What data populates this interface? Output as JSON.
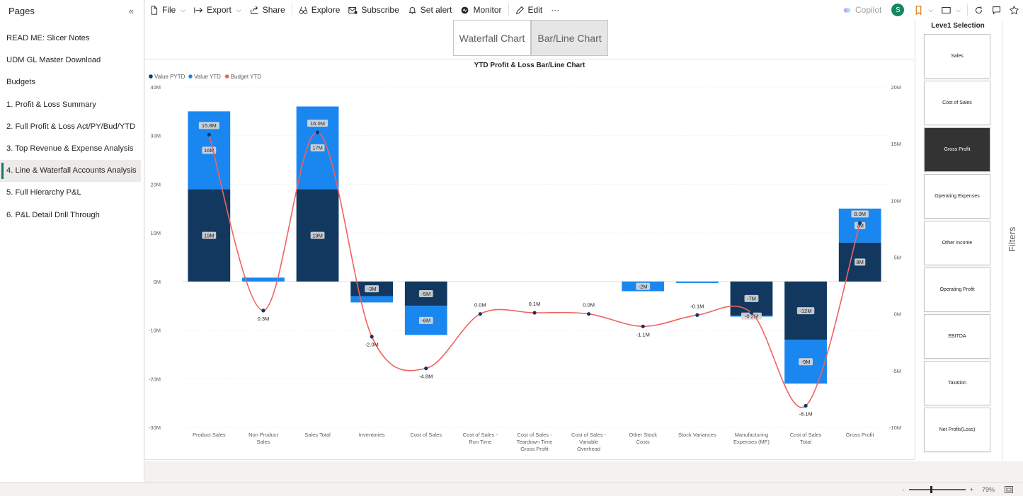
{
  "pages_pane": {
    "title": "Pages",
    "items": [
      {
        "label": "READ ME: Slicer Notes"
      },
      {
        "label": "UDM GL Master Download"
      },
      {
        "label": "Budgets"
      },
      {
        "label": "1. Profit & Loss Summary"
      },
      {
        "label": "2. Full Profit & Loss Act/PY/Bud/YTD"
      },
      {
        "label": "3. Top Revenue & Expense Analysis"
      },
      {
        "label": "4. Line & Waterfall Accounts Analysis"
      },
      {
        "label": "5. Full Hierarchy P&L"
      },
      {
        "label": "6. P&L Detail Drill Through"
      }
    ],
    "active_index": 6
  },
  "toolbar": {
    "file": "File",
    "export": "Export",
    "share": "Share",
    "explore": "Explore",
    "subscribe": "Subscribe",
    "set_alert": "Set alert",
    "monitor": "Monitor",
    "edit": "Edit",
    "more": "···",
    "copilot": "Copilot",
    "avatar_initial": "S"
  },
  "chart_tabs": {
    "waterfall": "Waterfall Chart",
    "barline": "Bar/Line Chart",
    "selected": "barline"
  },
  "slicer": {
    "title": "Leve1 Selection",
    "options": [
      "Sales",
      "Cost of Sales",
      "Gross Profit",
      "Operating Expenses",
      "Other Income",
      "Operating Profit",
      "EBITDA",
      "Taxation",
      "Net Profit/(Loss)"
    ],
    "selected": "Gross Profit"
  },
  "filters_label": "Filters",
  "status": {
    "minus": "-",
    "plus": "+",
    "zoom": "79%"
  },
  "colors": {
    "pytd": "#12385f",
    "ytd": "#1a87f0",
    "budget": "#f0625f",
    "accent": "#117865"
  },
  "chart_data": {
    "type": "bar",
    "title": "YTD Profit & Loss Bar/Line Chart",
    "legend_position": "top-left",
    "categories": [
      "Product Sales",
      "Non Product Sales",
      "Sales Total",
      "Inventories",
      "Cost of Sales",
      "Cost of Sales - Run Time",
      "Cost of Sales - Teardown Time Gross Profit",
      "Cost of Sales - Variable Overhead",
      "Other Stock Costs",
      "Stock Variances",
      "Manufacturing Expenses (MF)",
      "Cost of Sales Total",
      "Gross Profit"
    ],
    "left_axis": {
      "ticks": [
        "40M",
        "30M",
        "20M",
        "10M",
        "0M",
        "-10M",
        "-20M",
        "-30M"
      ],
      "range": [
        -30,
        40
      ]
    },
    "right_axis": {
      "ticks": [
        "20M",
        "15M",
        "10M",
        "5M",
        "0M",
        "-5M",
        "-10M"
      ],
      "range": [
        -10,
        20
      ]
    },
    "series": [
      {
        "name": "Value PYTD",
        "values": [
          19,
          0,
          19,
          -3,
          -5,
          0,
          0,
          0,
          0,
          0,
          -7,
          -12,
          8
        ],
        "labels": [
          "19M",
          "",
          "19M",
          "-3M",
          "-5M",
          "",
          "",
          "",
          "",
          "",
          "-7M",
          "-12M",
          "8M"
        ]
      },
      {
        "name": "Value YTD",
        "values": [
          16,
          0.8,
          17,
          -1.3,
          -6,
          0,
          0,
          0,
          -2,
          -0.3,
          -0.2,
          -9,
          7
        ],
        "labels": [
          "16M",
          "",
          "17M",
          "",
          "-6M",
          "",
          "",
          "",
          "-2M",
          "",
          "-0.2M",
          "-9M",
          "7M"
        ]
      },
      {
        "name": "Budget YTD",
        "values": [
          15.8,
          0.3,
          16.0,
          -2.0,
          -4.8,
          0.0,
          0.1,
          0.0,
          -1.1,
          -0.1,
          0.1,
          -8.1,
          8.0
        ],
        "labels": [
          "15.8M",
          "0.3M",
          "16.0M",
          "-2.0M",
          "-4.8M",
          "0.0M",
          "0.1M",
          "0.0M",
          "-1.1M",
          "-0.1M",
          "",
          "-8.1M",
          "8.0M"
        ]
      }
    ]
  }
}
